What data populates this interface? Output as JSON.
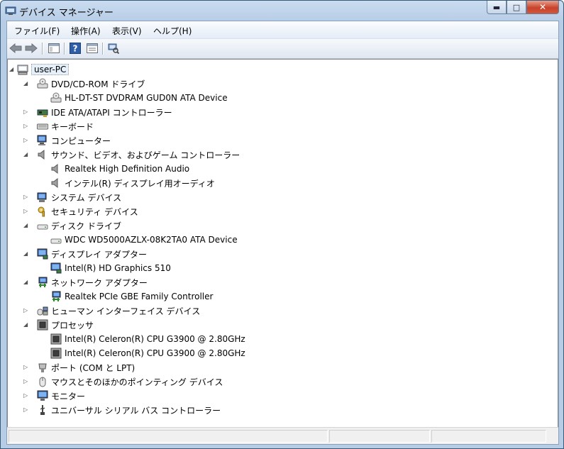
{
  "window": {
    "title": "デバイス マネージャー"
  },
  "menu": [
    "ファイル(F)",
    "操作(A)",
    "表示(V)",
    "ヘルプ(H)"
  ],
  "toolbar": {
    "icons": [
      "back-icon",
      "forward-icon",
      "show-hide-console-tree-icon",
      "help-icon",
      "properties-icon",
      "scan-hardware-icon"
    ]
  },
  "tree": {
    "root": "user-PC",
    "items": [
      {
        "label": "DVD/CD-ROM ドライブ",
        "icon": "dvd-drive-icon",
        "expanded": true
      },
      {
        "label": "HL-DT-ST DVDRAM GUD0N ATA Device",
        "icon": "dvd-drive-icon",
        "child": true
      },
      {
        "label": "IDE ATA/ATAPI コントローラー",
        "icon": "ide-controller-icon",
        "expanded": false
      },
      {
        "label": "キーボード",
        "icon": "keyboard-icon",
        "expanded": false
      },
      {
        "label": "コンピューター",
        "icon": "computer-icon",
        "expanded": false
      },
      {
        "label": "サウンド、ビデオ、およびゲーム コントローラー",
        "icon": "speaker-icon",
        "expanded": true
      },
      {
        "label": "Realtek High Definition Audio",
        "icon": "speaker-icon",
        "child": true
      },
      {
        "label": "インテル(R) ディスプレイ用オーディオ",
        "icon": "speaker-icon",
        "child": true
      },
      {
        "label": "システム デバイス",
        "icon": "system-device-icon",
        "expanded": false
      },
      {
        "label": "セキュリティ デバイス",
        "icon": "security-key-icon",
        "expanded": false
      },
      {
        "label": "ディスク ドライブ",
        "icon": "disk-drive-icon",
        "expanded": true
      },
      {
        "label": "WDC WD5000AZLX-08K2TA0 ATA Device",
        "icon": "disk-drive-icon",
        "child": true
      },
      {
        "label": "ディスプレイ アダプター",
        "icon": "display-adapter-icon",
        "expanded": true
      },
      {
        "label": "Intel(R) HD Graphics 510",
        "icon": "display-adapter-icon",
        "child": true
      },
      {
        "label": "ネットワーク アダプター",
        "icon": "network-adapter-icon",
        "expanded": true
      },
      {
        "label": "Realtek PCIe GBE Family Controller",
        "icon": "network-adapter-icon",
        "child": true
      },
      {
        "label": "ヒューマン インターフェイス デバイス",
        "icon": "hid-icon",
        "expanded": false
      },
      {
        "label": "プロセッサ",
        "icon": "processor-icon",
        "expanded": true
      },
      {
        "label": "Intel(R) Celeron(R) CPU G3900 @ 2.80GHz",
        "icon": "processor-icon",
        "child": true
      },
      {
        "label": "Intel(R) Celeron(R) CPU G3900 @ 2.80GHz",
        "icon": "processor-icon",
        "child": true
      },
      {
        "label": "ポート (COM と LPT)",
        "icon": "port-icon",
        "expanded": false
      },
      {
        "label": "マウスとそのほかのポインティング デバイス",
        "icon": "mouse-icon",
        "expanded": false
      },
      {
        "label": "モニター",
        "icon": "monitor-icon",
        "expanded": false
      },
      {
        "label": "ユニバーサル シリアル バス コントローラー",
        "icon": "usb-icon",
        "expanded": false
      }
    ]
  }
}
